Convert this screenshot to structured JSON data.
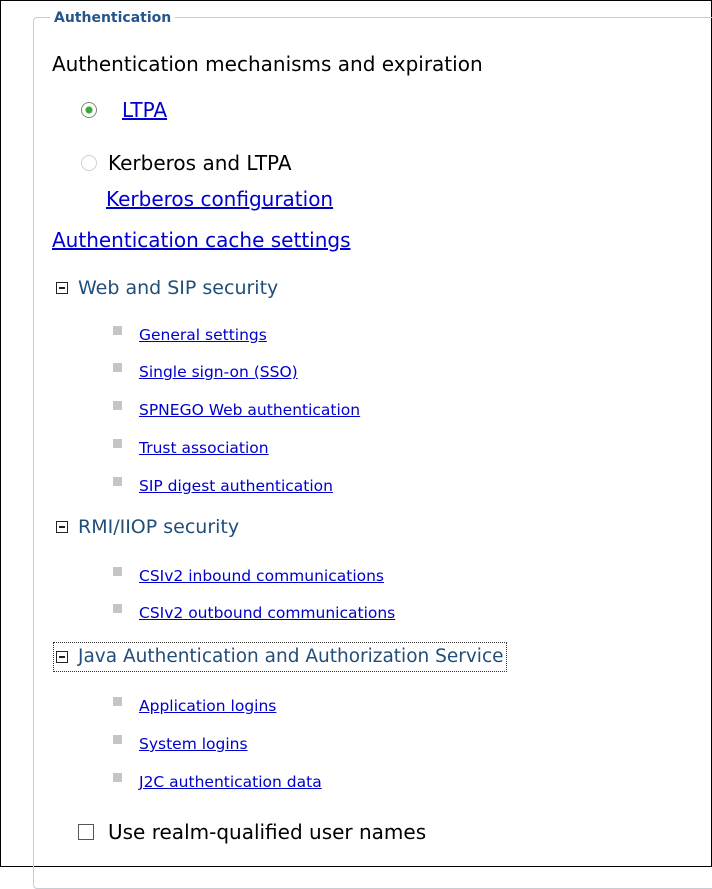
{
  "legend": "Authentication",
  "heading": "Authentication mechanisms and expiration",
  "mechanisms": {
    "ltpa_label": "LTPA",
    "kerberos_label": "Kerberos and LTPA",
    "kerberos_config_link": "Kerberos configuration",
    "selected": "LTPA"
  },
  "cache_link": "Authentication cache settings",
  "sections": {
    "web_sip": {
      "title": "Web and SIP security",
      "items": [
        "General settings",
        "Single sign-on (SSO)",
        "SPNEGO Web authentication",
        "Trust association",
        "SIP digest authentication"
      ]
    },
    "rmi_iiop": {
      "title": "RMI/IIOP security",
      "items": [
        "CSIv2 inbound communications",
        "CSIv2 outbound communications"
      ]
    },
    "jaas": {
      "title": "Java Authentication and Authorization Service",
      "items": [
        "Application logins",
        "System logins",
        "J2C authentication data"
      ]
    }
  },
  "realm_checkbox": {
    "label": "Use realm-qualified user names",
    "checked": false
  },
  "colors": {
    "link": "#0000cc",
    "section_title": "#224e7a",
    "legend": "#25568a",
    "bullet": "#c5c5c5",
    "radio_selected": "#39a839"
  },
  "icons": {
    "section_toggle": "collapse-minus-icon",
    "item_bullet": "square-bullet-icon"
  }
}
